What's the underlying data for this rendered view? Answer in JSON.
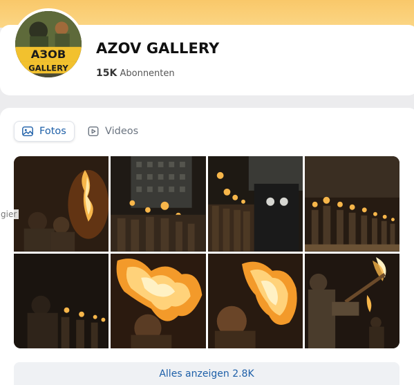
{
  "channel": {
    "name": "AZOV GALLERY",
    "subscriber_count": "15K",
    "subscriber_label": "Abonnenten",
    "avatar_text": {
      "line1": "АЗОВ",
      "line2": "GALLERY"
    }
  },
  "tabs": [
    {
      "label": "Fotos",
      "icon": "image-icon",
      "active": true
    },
    {
      "label": "Videos",
      "icon": "play-square-icon",
      "active": false
    }
  ],
  "side_text": "gier",
  "photos": [
    {
      "alt": "photo-1"
    },
    {
      "alt": "photo-2"
    },
    {
      "alt": "photo-3"
    },
    {
      "alt": "photo-4"
    },
    {
      "alt": "photo-5"
    },
    {
      "alt": "photo-6"
    },
    {
      "alt": "photo-7"
    },
    {
      "alt": "photo-8"
    }
  ],
  "show_all": {
    "label": "Alles anzeigen",
    "count": "2.8K"
  },
  "colors": {
    "accent": "#1d5fa8",
    "cover": "#f9c86a",
    "card": "#ffffff",
    "background": "#ececee"
  }
}
